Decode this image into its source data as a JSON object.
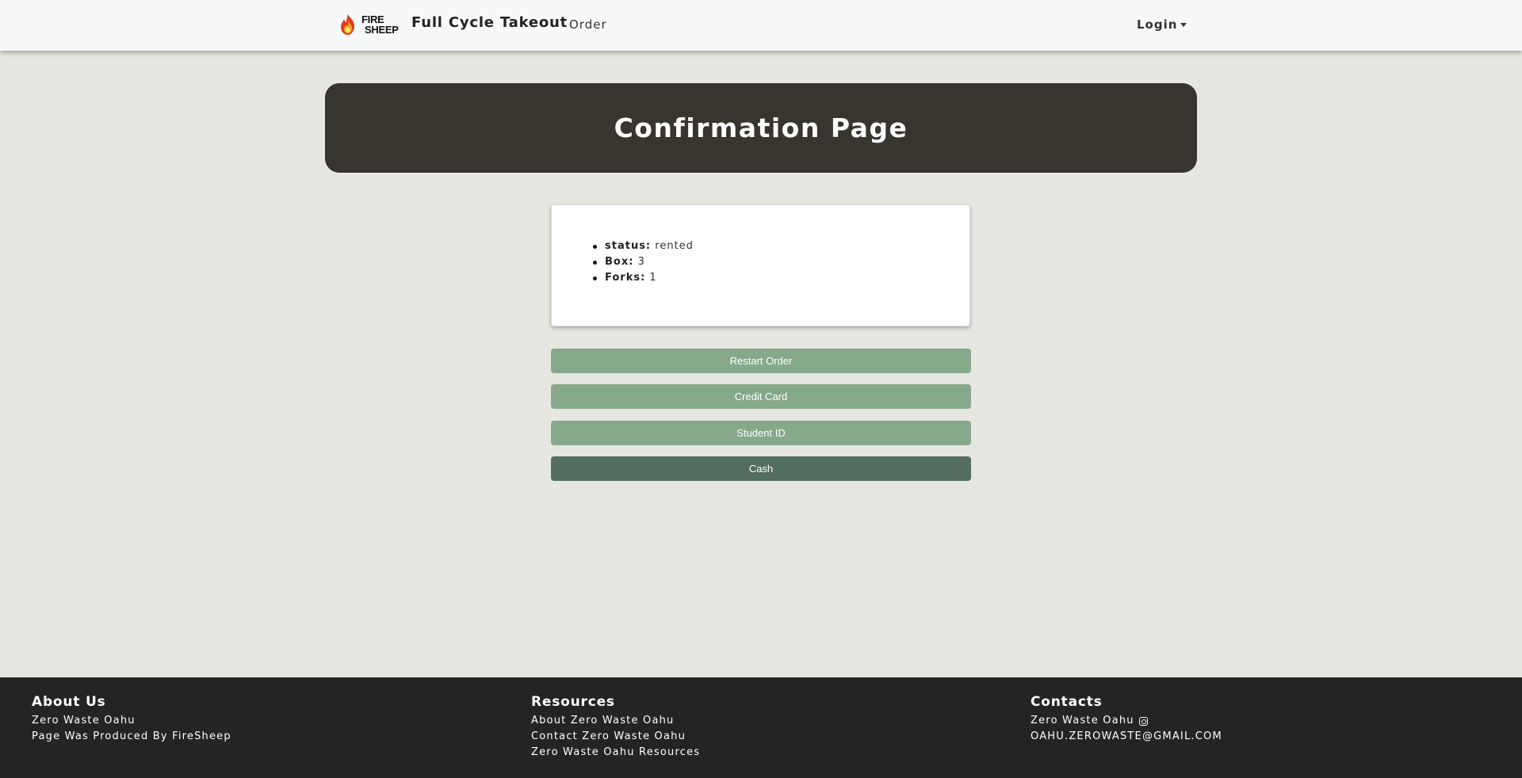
{
  "nav": {
    "logo_line1": "FIRE",
    "logo_line2": "SHEEP",
    "brand": "Full Cycle Takeout",
    "order": "Order",
    "login": "Login"
  },
  "hero": {
    "title": "Confirmation Page"
  },
  "details": [
    {
      "label": "status:",
      "value": "rented"
    },
    {
      "label": "Box:",
      "value": "3"
    },
    {
      "label": "Forks:",
      "value": "1"
    }
  ],
  "buttons": {
    "restart": "Restart Order",
    "credit": "Credit Card",
    "student": "Student ID",
    "cash": "Cash"
  },
  "footer": {
    "about": {
      "title": "About Us",
      "lines": [
        "Zero Waste Oahu",
        "Page Was Produced By FireSheep"
      ]
    },
    "resources": {
      "title": "Resources",
      "lines": [
        "About Zero Waste Oahu",
        "Contact Zero Waste Oahu",
        "Zero Waste Oahu Resources"
      ]
    },
    "contacts": {
      "title": "Contacts",
      "lines": [
        "Zero Waste Oahu",
        "OAHU.ZEROWASTE@GMAIL.COM"
      ],
      "icon": "instagram-icon"
    }
  },
  "colors": {
    "background": "#e6e7e0",
    "hero": "#38352f",
    "button": "#86a88b",
    "button_active": "#546e60",
    "footer": "#242424"
  }
}
